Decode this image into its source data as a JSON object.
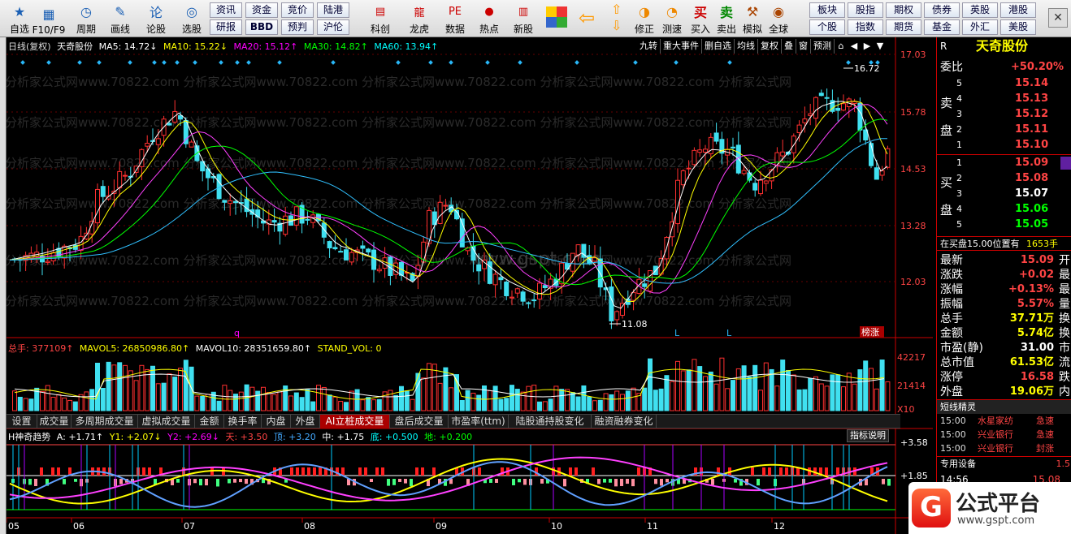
{
  "toolbar": {
    "main": [
      {
        "label": "自选",
        "icon": "star-icon"
      },
      {
        "label": "F10/F9",
        "icon": "f10-icon"
      },
      {
        "label": "周期",
        "icon": "clock-icon"
      },
      {
        "label": "画线",
        "icon": "pen-icon"
      },
      {
        "label": "论股",
        "icon": "forum-icon"
      },
      {
        "label": "选股",
        "icon": "select-icon"
      }
    ],
    "grid1": [
      [
        "资讯",
        "研报"
      ],
      [
        "资金",
        "BBD"
      ],
      [
        "竞价",
        "预判"
      ],
      [
        "陆港",
        "沪伦"
      ]
    ],
    "mid": [
      {
        "label": "科创",
        "icon": "kechuang-icon"
      },
      {
        "label": "龙虎",
        "icon": "dragon-icon"
      },
      {
        "label": "数据",
        "icon": "data-icon"
      },
      {
        "label": "热点",
        "icon": "hot-icon"
      },
      {
        "label": "新股",
        "icon": "newstock-icon"
      }
    ],
    "nav": [
      {
        "label": "修正",
        "icon": "fix-icon"
      },
      {
        "label": "测速",
        "icon": "speed-icon"
      }
    ],
    "trade": [
      {
        "label": "买入",
        "icon": "buy-icon",
        "glyph": "买"
      },
      {
        "label": "卖出",
        "icon": "sell-icon",
        "glyph": "卖"
      },
      {
        "label": "模拟",
        "icon": "hammer-icon"
      },
      {
        "label": "全球",
        "icon": "globe-icon"
      }
    ],
    "grid2": [
      [
        "板块",
        "个股"
      ],
      [
        "股指",
        "指数"
      ],
      [
        "期权",
        "期货"
      ],
      [
        "债券",
        "基金"
      ],
      [
        "英股",
        "外汇"
      ],
      [
        "港股",
        "美股"
      ]
    ]
  },
  "chart": {
    "header": {
      "period": "日线(复权)",
      "name": "天奇股份",
      "ma5": "MA5: 14.72↓",
      "ma10": "MA10: 15.22↓",
      "ma20": "MA20: 15.12↑",
      "ma30": "MA30: 14.82↑",
      "ma60": "MA60: 13.94↑"
    },
    "buttons": [
      "九转",
      "重大事件",
      "删自选",
      "均线",
      "复权",
      "叠",
      "窗",
      "预测"
    ],
    "price_axis": [
      "17.03",
      "15.78",
      "14.53",
      "13.28",
      "12.03"
    ],
    "high_label": "16.72",
    "low_label": "11.08",
    "markers": [
      "q",
      "L",
      "L"
    ],
    "badge": "榜涨",
    "watermark_row": "分析家公式网www.70822.com 分析家公式网www.70822.com 分析家公式网www.70822.com 分析家公式网www.70822.com 分析家公式网",
    "center_wm": "www.gspt.com",
    "vol": {
      "total": "总手: 377109↑",
      "mavol5": "MAVOL5: 26850986.80↑",
      "mavol10": "MAVOL10: 28351659.80↑",
      "stand": "STAND_VOL: 0",
      "axis": [
        "42217",
        "21414",
        "X10"
      ]
    },
    "tabs": [
      "设置",
      "成交量",
      "多周期成交量",
      "虚拟成交量",
      "金额",
      "换手率",
      "内盘",
      "外盘",
      "AI立桩成交量",
      "盘后成交量",
      "市盈率(ttm)",
      "陆股通持股变化",
      "融资融券变化"
    ],
    "active_tab": "AI立桩成交量",
    "ind": {
      "name": "H神奇趋势",
      "a": "A: +1.71↑",
      "y1": "Y1: +2.07↓",
      "y2": "Y2: +2.69↓",
      "tian": "天: +3.50",
      "ding": "顶: +3.20",
      "zhong": "中: +1.75",
      "di": "底: +0.500",
      "de": "地: +0.200",
      "help": "指标说明",
      "axis": [
        "+3.58",
        "+1.85"
      ]
    },
    "months": [
      "05",
      "06",
      "07",
      "08",
      "09",
      "10",
      "11",
      "12"
    ]
  },
  "quote": {
    "code": "R",
    "name": "天奇股份",
    "ratio_label": "委比",
    "ratio": "+50.20%",
    "asks": [
      {
        "n": "5",
        "p": "15.14"
      },
      {
        "n": "4",
        "p": "15.13"
      },
      {
        "n": "3",
        "p": "15.12"
      },
      {
        "n": "2",
        "p": "15.11"
      },
      {
        "n": "1",
        "p": "15.10"
      }
    ],
    "bids": [
      {
        "n": "1",
        "p": "15.09"
      },
      {
        "n": "2",
        "p": "15.08"
      },
      {
        "n": "3",
        "p": "15.07"
      },
      {
        "n": "4",
        "p": "15.06"
      },
      {
        "n": "5",
        "p": "15.05"
      }
    ],
    "sell_label": [
      "卖",
      "盘"
    ],
    "buy_label": [
      "买",
      "盘"
    ],
    "notice": "在买盘15.00位置有",
    "notice2": "1653手",
    "stats": [
      {
        "k": "最新",
        "v": "15.09",
        "x": "开"
      },
      {
        "k": "涨跌",
        "v": "+0.02",
        "x": "最"
      },
      {
        "k": "涨幅",
        "v": "+0.13%",
        "x": "最"
      },
      {
        "k": "振幅",
        "v": "5.57%",
        "x": "量"
      },
      {
        "k": "总手",
        "v": "37.71万",
        "x": "换"
      },
      {
        "k": "金额",
        "v": "5.74亿",
        "x": "换"
      },
      {
        "k": "市盈(静)",
        "v": "31.00",
        "x": "市"
      },
      {
        "k": "总市值",
        "v": "61.53亿",
        "x": "流"
      },
      {
        "k": "涨停",
        "v": "16.58",
        "x": "跌"
      },
      {
        "k": "外盘",
        "v": "19.06万",
        "x": "内"
      }
    ],
    "elf_title": "短线精灵",
    "elf": [
      {
        "t": "15:00",
        "s": "水星家纺",
        "e": "急速"
      },
      {
        "t": "15:00",
        "s": "兴业银行",
        "e": "急速"
      },
      {
        "t": "15:00",
        "s": "兴业银行",
        "e": "封涨"
      }
    ],
    "device": "专用设备",
    "dev_v": "1.5",
    "tick": {
      "t": "14:56",
      "p": "15.08"
    }
  },
  "logo": {
    "text": "公式平台",
    "url": "www.gspt.com"
  }
}
